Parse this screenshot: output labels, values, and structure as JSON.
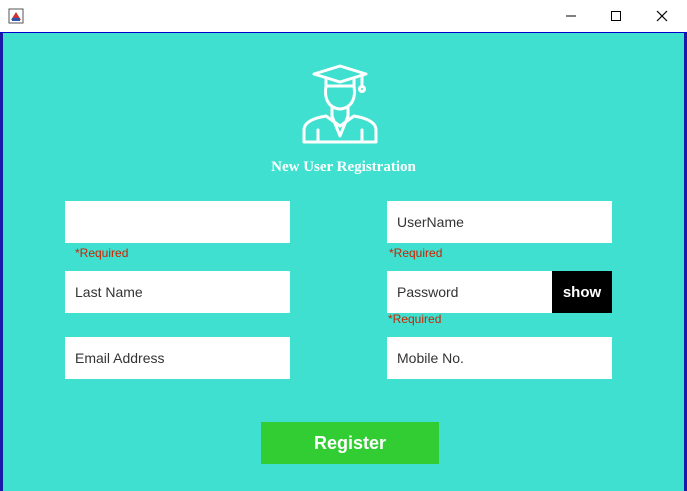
{
  "window": {
    "icon": "java-app-icon",
    "controls": {
      "minimize": "minimize-icon",
      "maximize": "maximize-icon",
      "close": "close-icon"
    }
  },
  "header": {
    "logo_icon": "graduate-user-icon",
    "title": "New User Registration"
  },
  "form": {
    "first_name": {
      "value": "",
      "required_text": "*Required"
    },
    "username": {
      "value": "UserName",
      "required_text": "*Required"
    },
    "last_name": {
      "value": "Last Name"
    },
    "password": {
      "value": "Password",
      "required_text": "*Required",
      "show_label": "show"
    },
    "email": {
      "value": "Email Address"
    },
    "mobile": {
      "value": "Mobile No."
    }
  },
  "actions": {
    "register_label": "Register"
  },
  "colors": {
    "background": "#40e0d0",
    "register": "#32cd32",
    "required": "#cc2200",
    "show_button": "#000000"
  }
}
